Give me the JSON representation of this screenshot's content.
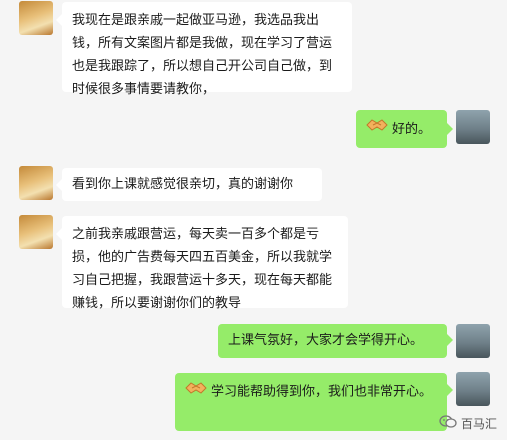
{
  "messages": [
    {
      "side": "left",
      "text": "我现在是跟亲戚一起做亚马逊，我选品我出钱，所有文案图片都是我做，现在学习了营运也是我跟踪了，所以想自己开公司自己做，到时候很多事情要请教你，"
    },
    {
      "side": "right",
      "emoji": "handshake-icon",
      "text": "好的。"
    },
    {
      "side": "left",
      "text": "看到你上课就感觉很亲切，真的谢谢你"
    },
    {
      "side": "left",
      "text": "之前我亲戚跟营运，每天卖一百多个都是亏损，他的广告费每天四五百美金，所以我就学习自己把握，我跟营运十多天，现在每天都能赚钱，所以要谢谢你们的教导"
    },
    {
      "side": "right",
      "text": "上课气氛好，大家才会学得开心。"
    },
    {
      "side": "right",
      "emoji": "handshake-icon",
      "text": "学习能帮助得到你，我们也非常开心。"
    }
  ],
  "watermark": {
    "text": "百马汇",
    "icon": "wechat-channel-icon"
  }
}
